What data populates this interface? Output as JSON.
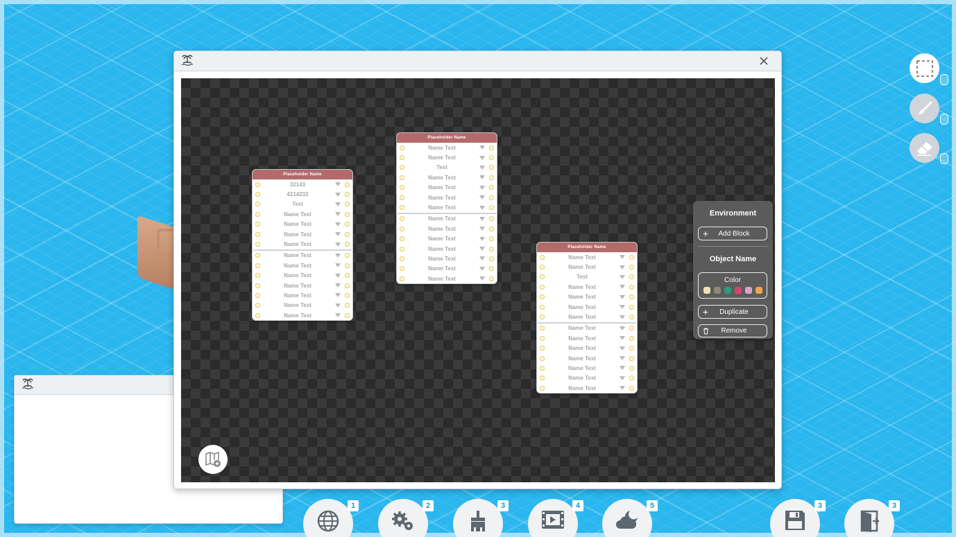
{
  "nodes": [
    {
      "title": "Placeholder Name",
      "group1": [
        "32143",
        "4214232",
        "Test",
        "Name Text",
        "Name Text",
        "Name Text",
        "Name Text"
      ],
      "group2": [
        "Name Text",
        "Name Text",
        "Name Text",
        "Name Text",
        "Name Text",
        "Name Text",
        "Name Text"
      ]
    },
    {
      "title": "Placeholder Name",
      "group1": [
        "Name Text",
        "Name Text",
        "Test",
        "Name Text",
        "Name Text",
        "Name Text",
        "Name Text"
      ],
      "group2": [
        "Name Text",
        "Name Text",
        "Name Text",
        "Name Text",
        "Name Text",
        "Name Text",
        "Name Text"
      ]
    },
    {
      "title": "Placeholder Name",
      "group1": [
        "Name Text",
        "Name Text",
        "Test",
        "Name Text",
        "Name Text",
        "Name Text",
        "Name Text"
      ],
      "group2": [
        "Name Text",
        "Name Text",
        "Name Text",
        "Name Text",
        "Name Text",
        "Name Text",
        "Name Text"
      ]
    }
  ],
  "context_panel": {
    "environment_label": "Environment",
    "add_block_label": "Add Block",
    "object_name": "Object Name",
    "color_label": "Color",
    "swatches": [
      "#efe2b4",
      "#8e8a77",
      "#2a9d7a",
      "#d9436b",
      "#d9a6c9",
      "#efa64a"
    ],
    "duplicate_label": "Duplicate",
    "remove_label": "Remove"
  },
  "tools": [
    "select-tool",
    "brush-tool",
    "eraser-tool"
  ],
  "bottom_toolbar": [
    {
      "icon": "globe-icon",
      "badge": "1"
    },
    {
      "icon": "gears-icon",
      "badge": "2"
    },
    {
      "icon": "brush-icon",
      "badge": "3"
    },
    {
      "icon": "film-icon",
      "badge": "4"
    },
    {
      "icon": "cloud-moon-icon",
      "badge": "5"
    },
    {
      "icon": "save-icon",
      "badge": "3"
    },
    {
      "icon": "exit-door-icon",
      "badge": "3"
    }
  ],
  "colors": {
    "node_header": "#b46a6a",
    "canvas": "#2b2b2b",
    "panel": "#5b5b5b",
    "ocean": "#2ab6ee"
  }
}
